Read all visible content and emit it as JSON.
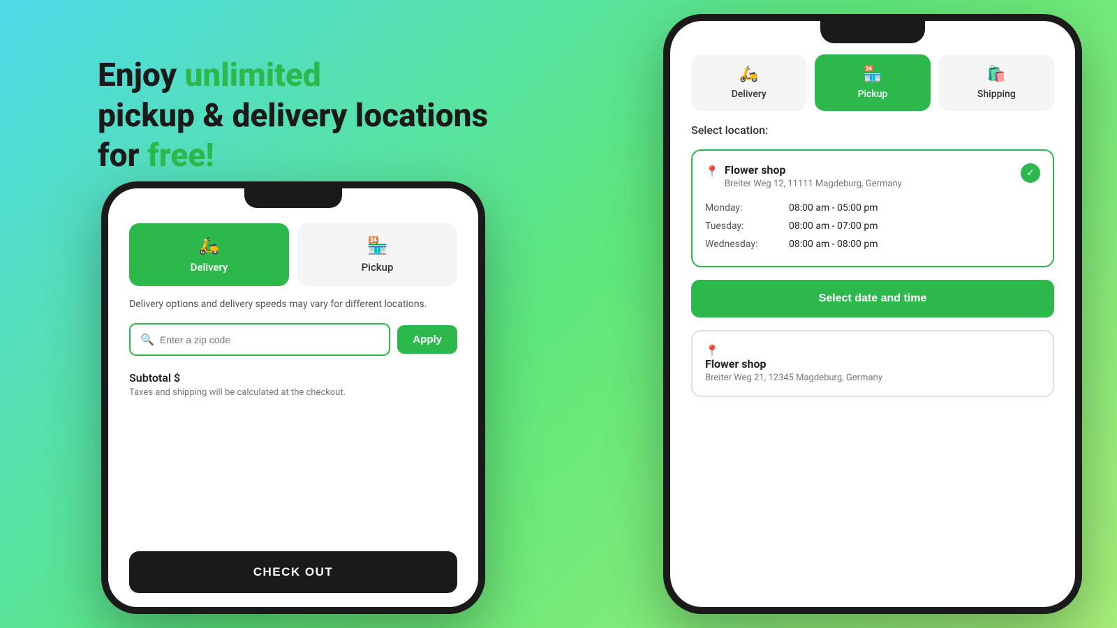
{
  "hero": {
    "line1_normal": "Enjoy ",
    "line1_green": "unlimited",
    "line2": "pickup & delivery locations",
    "line3_normal": "for ",
    "line3_green": "free!"
  },
  "phone1": {
    "tabs": [
      {
        "label": "Delivery",
        "icon": "🛵",
        "active": true
      },
      {
        "label": "Pickup",
        "icon": "🏪",
        "active": false
      }
    ],
    "description": "Delivery options and delivery speeds may vary for different locations.",
    "zip_placeholder": "Enter a zip code",
    "apply_label": "Apply",
    "subtotal_label": "Subtotal $",
    "subtotal_note": "Taxes and shipping will be calculated at the checkout.",
    "checkout_label": "CHECK OUT"
  },
  "phone2": {
    "tabs": [
      {
        "label": "Delivery",
        "icon": "🛵",
        "active": false
      },
      {
        "label": "Pickup",
        "icon": "🏪",
        "active": true
      },
      {
        "label": "Shipping",
        "icon": "🛍️",
        "active": false
      }
    ],
    "select_location_label": "Select location:",
    "location1": {
      "name": "Flower shop",
      "address": "Breiter Weg 12, 11111 Magdeburg, Germany",
      "selected": true,
      "hours": [
        {
          "day": "Monday:",
          "time": "08:00 am - 05:00 pm"
        },
        {
          "day": "Tuesday:",
          "time": "08:00 am - 07:00 pm"
        },
        {
          "day": "Wednesday:",
          "time": "08:00 am - 08:00 pm"
        }
      ]
    },
    "select_dt_label": "Select date and time",
    "location2": {
      "name": "Flower shop",
      "address": "Breiter Weg 21, 12345 Magdeburg, Germany"
    }
  }
}
